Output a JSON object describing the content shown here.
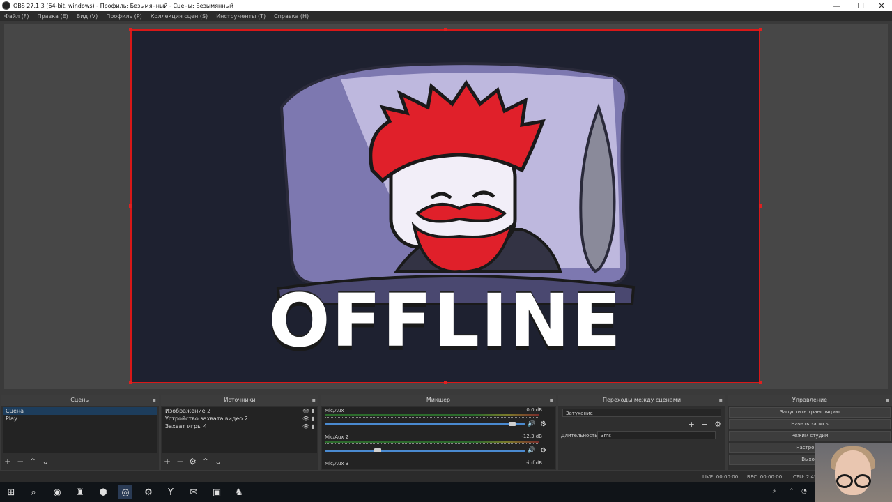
{
  "window": {
    "title": "OBS 27.1.3 (64-bit, windows) - Профиль: Безымянный - Сцены: Безымянный",
    "controls": [
      "—",
      "☐",
      "✕"
    ]
  },
  "menu": [
    "Файл (F)",
    "Правка (E)",
    "Вид (V)",
    "Профиль (P)",
    "Коллекция сцен (S)",
    "Инструменты (T)",
    "Справка (H)"
  ],
  "preview": {
    "overlay_text": "OFFLINE",
    "border_color": "#d81818"
  },
  "docks": {
    "scenes": {
      "title": "Сцены",
      "items": [
        "Сцена",
        "Play"
      ],
      "selected_index": 0
    },
    "sources": {
      "title": "Источники",
      "items": [
        "Изображение 2",
        "Устройство захвата видео 2",
        "Захват игры 4"
      ]
    },
    "mixer": {
      "title": "Микшер",
      "channels": [
        {
          "name": "Mic/Aux",
          "db": "0.0 dB",
          "level": 0.95
        },
        {
          "name": "Mic/Aux 2",
          "db": "-12.3 dB",
          "level": 0.28
        },
        {
          "name": "Mic/Aux 3",
          "db": "-inf dB",
          "level": 0
        }
      ]
    },
    "transitions": {
      "title": "Переходы между сценами",
      "selected": "Затухание",
      "duration_label": "Длительность",
      "duration_value": "3ms"
    },
    "controls": {
      "title": "Управление",
      "buttons": [
        "Запустить трансляцию",
        "Начать запись",
        "Режим студии",
        "Настройки",
        "Выход"
      ]
    }
  },
  "status": {
    "live": "LIVE: 00:00:00",
    "rec": "REC: 00:00:00",
    "cpu": "CPU: 2.4%"
  },
  "taskbar": {
    "apps": [
      "start-icon",
      "search-icon",
      "chrome-icon",
      "game-icon",
      "shield-icon",
      "obs-icon",
      "steam-icon",
      "yandex-icon",
      "mail-icon",
      "photos-icon",
      "app-icon"
    ],
    "active_index": 5
  }
}
